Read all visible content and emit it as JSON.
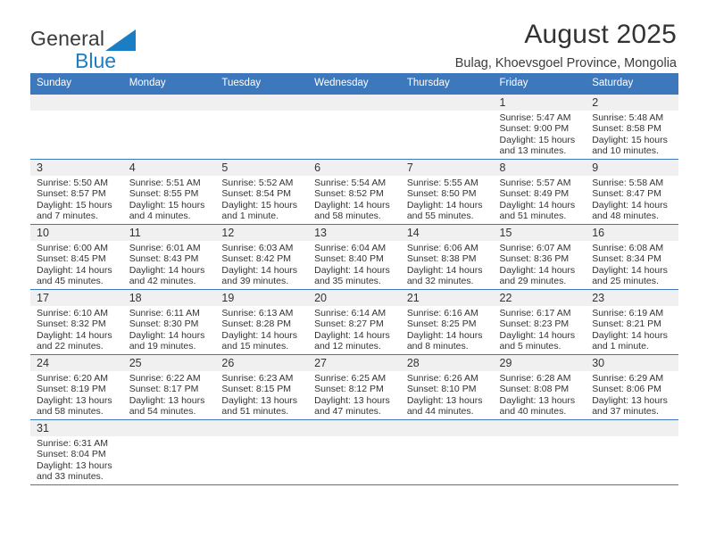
{
  "brand": {
    "name_top": "General",
    "name_bottom": "Blue",
    "triangle_color": "#1b7ec4",
    "text_color": "#3a3a3a",
    "blue_color": "#1b7ec4"
  },
  "header": {
    "title": "August 2025",
    "subtitle": "Bulag, Khoevsgoel Province, Mongolia"
  },
  "theme": {
    "header_blue": "#3d78bd",
    "daynum_band": "#f0f0f0",
    "text": "#333333"
  },
  "weekdays": [
    "Sunday",
    "Monday",
    "Tuesday",
    "Wednesday",
    "Thursday",
    "Friday",
    "Saturday"
  ],
  "weeks": [
    [
      {
        "day": "",
        "sunrise": "",
        "sunset": "",
        "daylight_1": "",
        "daylight_2": ""
      },
      {
        "day": "",
        "sunrise": "",
        "sunset": "",
        "daylight_1": "",
        "daylight_2": ""
      },
      {
        "day": "",
        "sunrise": "",
        "sunset": "",
        "daylight_1": "",
        "daylight_2": ""
      },
      {
        "day": "",
        "sunrise": "",
        "sunset": "",
        "daylight_1": "",
        "daylight_2": ""
      },
      {
        "day": "",
        "sunrise": "",
        "sunset": "",
        "daylight_1": "",
        "daylight_2": ""
      },
      {
        "day": "1",
        "sunrise": "Sunrise: 5:47 AM",
        "sunset": "Sunset: 9:00 PM",
        "daylight_1": "Daylight: 15 hours",
        "daylight_2": "and 13 minutes."
      },
      {
        "day": "2",
        "sunrise": "Sunrise: 5:48 AM",
        "sunset": "Sunset: 8:58 PM",
        "daylight_1": "Daylight: 15 hours",
        "daylight_2": "and 10 minutes."
      }
    ],
    [
      {
        "day": "3",
        "sunrise": "Sunrise: 5:50 AM",
        "sunset": "Sunset: 8:57 PM",
        "daylight_1": "Daylight: 15 hours",
        "daylight_2": "and 7 minutes."
      },
      {
        "day": "4",
        "sunrise": "Sunrise: 5:51 AM",
        "sunset": "Sunset: 8:55 PM",
        "daylight_1": "Daylight: 15 hours",
        "daylight_2": "and 4 minutes."
      },
      {
        "day": "5",
        "sunrise": "Sunrise: 5:52 AM",
        "sunset": "Sunset: 8:54 PM",
        "daylight_1": "Daylight: 15 hours",
        "daylight_2": "and 1 minute."
      },
      {
        "day": "6",
        "sunrise": "Sunrise: 5:54 AM",
        "sunset": "Sunset: 8:52 PM",
        "daylight_1": "Daylight: 14 hours",
        "daylight_2": "and 58 minutes."
      },
      {
        "day": "7",
        "sunrise": "Sunrise: 5:55 AM",
        "sunset": "Sunset: 8:50 PM",
        "daylight_1": "Daylight: 14 hours",
        "daylight_2": "and 55 minutes."
      },
      {
        "day": "8",
        "sunrise": "Sunrise: 5:57 AM",
        "sunset": "Sunset: 8:49 PM",
        "daylight_1": "Daylight: 14 hours",
        "daylight_2": "and 51 minutes."
      },
      {
        "day": "9",
        "sunrise": "Sunrise: 5:58 AM",
        "sunset": "Sunset: 8:47 PM",
        "daylight_1": "Daylight: 14 hours",
        "daylight_2": "and 48 minutes."
      }
    ],
    [
      {
        "day": "10",
        "sunrise": "Sunrise: 6:00 AM",
        "sunset": "Sunset: 8:45 PM",
        "daylight_1": "Daylight: 14 hours",
        "daylight_2": "and 45 minutes."
      },
      {
        "day": "11",
        "sunrise": "Sunrise: 6:01 AM",
        "sunset": "Sunset: 8:43 PM",
        "daylight_1": "Daylight: 14 hours",
        "daylight_2": "and 42 minutes."
      },
      {
        "day": "12",
        "sunrise": "Sunrise: 6:03 AM",
        "sunset": "Sunset: 8:42 PM",
        "daylight_1": "Daylight: 14 hours",
        "daylight_2": "and 39 minutes."
      },
      {
        "day": "13",
        "sunrise": "Sunrise: 6:04 AM",
        "sunset": "Sunset: 8:40 PM",
        "daylight_1": "Daylight: 14 hours",
        "daylight_2": "and 35 minutes."
      },
      {
        "day": "14",
        "sunrise": "Sunrise: 6:06 AM",
        "sunset": "Sunset: 8:38 PM",
        "daylight_1": "Daylight: 14 hours",
        "daylight_2": "and 32 minutes."
      },
      {
        "day": "15",
        "sunrise": "Sunrise: 6:07 AM",
        "sunset": "Sunset: 8:36 PM",
        "daylight_1": "Daylight: 14 hours",
        "daylight_2": "and 29 minutes."
      },
      {
        "day": "16",
        "sunrise": "Sunrise: 6:08 AM",
        "sunset": "Sunset: 8:34 PM",
        "daylight_1": "Daylight: 14 hours",
        "daylight_2": "and 25 minutes."
      }
    ],
    [
      {
        "day": "17",
        "sunrise": "Sunrise: 6:10 AM",
        "sunset": "Sunset: 8:32 PM",
        "daylight_1": "Daylight: 14 hours",
        "daylight_2": "and 22 minutes."
      },
      {
        "day": "18",
        "sunrise": "Sunrise: 6:11 AM",
        "sunset": "Sunset: 8:30 PM",
        "daylight_1": "Daylight: 14 hours",
        "daylight_2": "and 19 minutes."
      },
      {
        "day": "19",
        "sunrise": "Sunrise: 6:13 AM",
        "sunset": "Sunset: 8:28 PM",
        "daylight_1": "Daylight: 14 hours",
        "daylight_2": "and 15 minutes."
      },
      {
        "day": "20",
        "sunrise": "Sunrise: 6:14 AM",
        "sunset": "Sunset: 8:27 PM",
        "daylight_1": "Daylight: 14 hours",
        "daylight_2": "and 12 minutes."
      },
      {
        "day": "21",
        "sunrise": "Sunrise: 6:16 AM",
        "sunset": "Sunset: 8:25 PM",
        "daylight_1": "Daylight: 14 hours",
        "daylight_2": "and 8 minutes."
      },
      {
        "day": "22",
        "sunrise": "Sunrise: 6:17 AM",
        "sunset": "Sunset: 8:23 PM",
        "daylight_1": "Daylight: 14 hours",
        "daylight_2": "and 5 minutes."
      },
      {
        "day": "23",
        "sunrise": "Sunrise: 6:19 AM",
        "sunset": "Sunset: 8:21 PM",
        "daylight_1": "Daylight: 14 hours",
        "daylight_2": "and 1 minute."
      }
    ],
    [
      {
        "day": "24",
        "sunrise": "Sunrise: 6:20 AM",
        "sunset": "Sunset: 8:19 PM",
        "daylight_1": "Daylight: 13 hours",
        "daylight_2": "and 58 minutes."
      },
      {
        "day": "25",
        "sunrise": "Sunrise: 6:22 AM",
        "sunset": "Sunset: 8:17 PM",
        "daylight_1": "Daylight: 13 hours",
        "daylight_2": "and 54 minutes."
      },
      {
        "day": "26",
        "sunrise": "Sunrise: 6:23 AM",
        "sunset": "Sunset: 8:15 PM",
        "daylight_1": "Daylight: 13 hours",
        "daylight_2": "and 51 minutes."
      },
      {
        "day": "27",
        "sunrise": "Sunrise: 6:25 AM",
        "sunset": "Sunset: 8:12 PM",
        "daylight_1": "Daylight: 13 hours",
        "daylight_2": "and 47 minutes."
      },
      {
        "day": "28",
        "sunrise": "Sunrise: 6:26 AM",
        "sunset": "Sunset: 8:10 PM",
        "daylight_1": "Daylight: 13 hours",
        "daylight_2": "and 44 minutes."
      },
      {
        "day": "29",
        "sunrise": "Sunrise: 6:28 AM",
        "sunset": "Sunset: 8:08 PM",
        "daylight_1": "Daylight: 13 hours",
        "daylight_2": "and 40 minutes."
      },
      {
        "day": "30",
        "sunrise": "Sunrise: 6:29 AM",
        "sunset": "Sunset: 8:06 PM",
        "daylight_1": "Daylight: 13 hours",
        "daylight_2": "and 37 minutes."
      }
    ],
    [
      {
        "day": "31",
        "sunrise": "Sunrise: 6:31 AM",
        "sunset": "Sunset: 8:04 PM",
        "daylight_1": "Daylight: 13 hours",
        "daylight_2": "and 33 minutes."
      },
      {
        "day": "",
        "sunrise": "",
        "sunset": "",
        "daylight_1": "",
        "daylight_2": ""
      },
      {
        "day": "",
        "sunrise": "",
        "sunset": "",
        "daylight_1": "",
        "daylight_2": ""
      },
      {
        "day": "",
        "sunrise": "",
        "sunset": "",
        "daylight_1": "",
        "daylight_2": ""
      },
      {
        "day": "",
        "sunrise": "",
        "sunset": "",
        "daylight_1": "",
        "daylight_2": ""
      },
      {
        "day": "",
        "sunrise": "",
        "sunset": "",
        "daylight_1": "",
        "daylight_2": ""
      },
      {
        "day": "",
        "sunrise": "",
        "sunset": "",
        "daylight_1": "",
        "daylight_2": ""
      }
    ]
  ]
}
